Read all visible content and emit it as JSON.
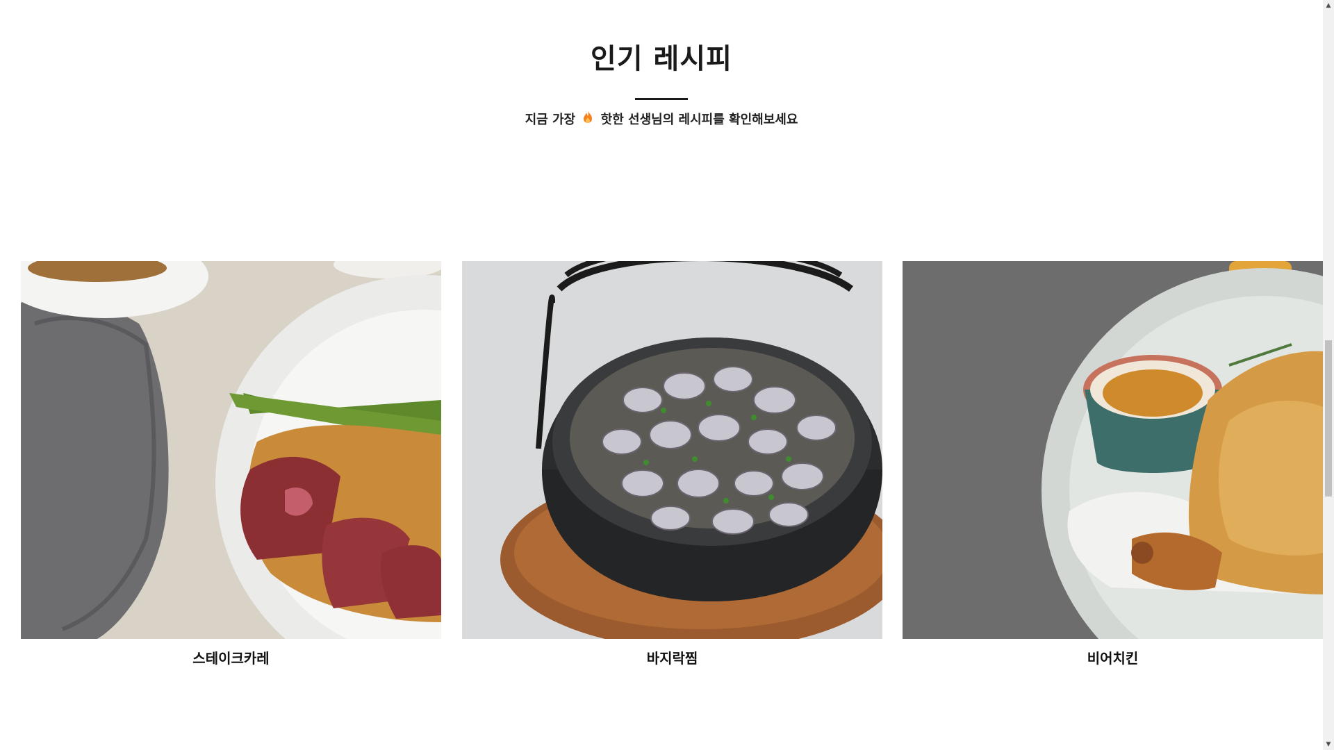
{
  "section": {
    "title": "인기 레시피",
    "subtitle_before": "지금 가장",
    "subtitle_icon": "fire-icon",
    "subtitle_after": "핫한 선생님의 레시피를 확인해보세요"
  },
  "recipes": [
    {
      "name": "스테이크카레",
      "image": "steak-curry-photo"
    },
    {
      "name": "바지락찜",
      "image": "steamed-clams-photo"
    },
    {
      "name": "비어치킨",
      "image": "beer-chicken-photo"
    }
  ],
  "colors": {
    "text": "#1a1a1a",
    "flame": "#f5821f",
    "scrollbar_track": "#f1f1f1",
    "scrollbar_thumb": "#c1c1c1"
  }
}
